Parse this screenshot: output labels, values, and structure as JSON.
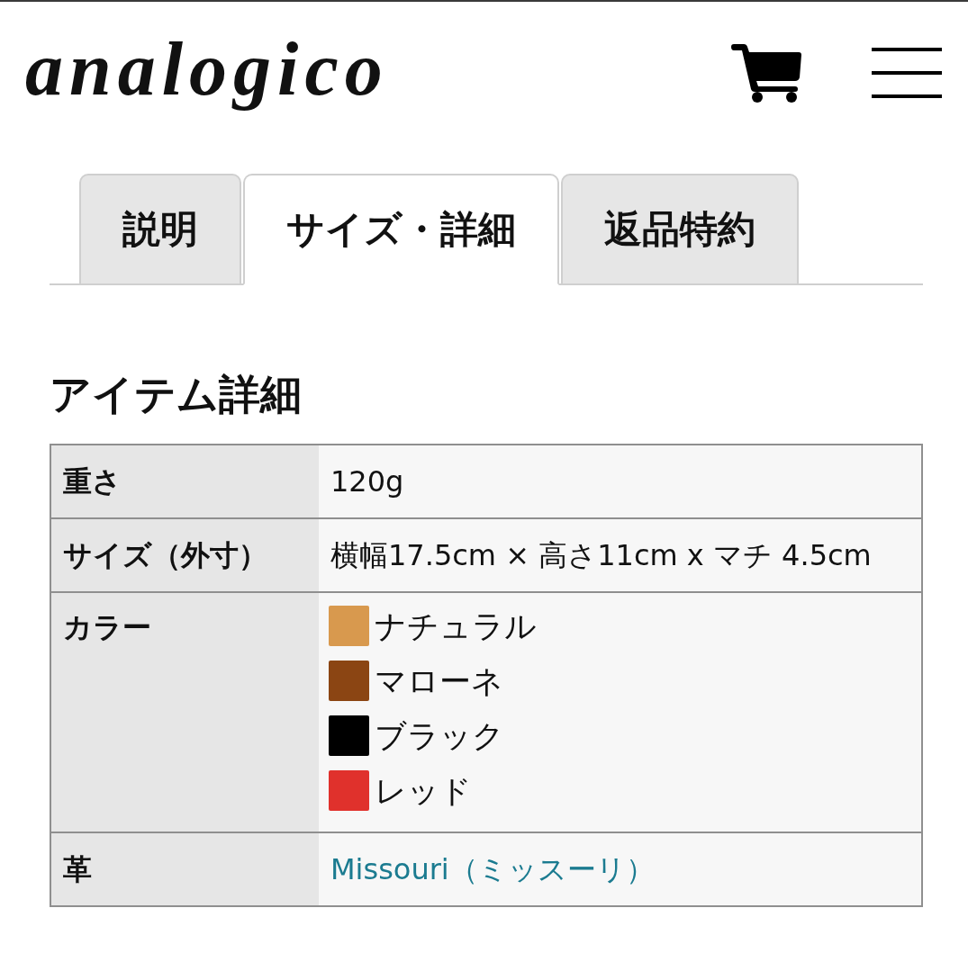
{
  "header": {
    "logo": "analogico"
  },
  "tabs": [
    {
      "label": "説明",
      "selected": false
    },
    {
      "label": "サイズ・詳細",
      "selected": true
    },
    {
      "label": "返品特約",
      "selected": false
    }
  ],
  "section": {
    "title": "アイテム詳細"
  },
  "table": {
    "rows": [
      {
        "kind": "text",
        "label": "重さ",
        "value": "120g"
      },
      {
        "kind": "text",
        "label": "サイズ（外寸）",
        "value": "横幅17.5cm × 高さ11cm x マチ 4.5cm"
      },
      {
        "kind": "colors",
        "label": "カラー",
        "colors": [
          {
            "name": "ナチュラル",
            "color": "#d8994e"
          },
          {
            "name": "マローネ",
            "color": "#8b4513"
          },
          {
            "name": "ブラック",
            "color": "#000000"
          },
          {
            "name": "レッド",
            "color": "#e0312c"
          }
        ]
      },
      {
        "kind": "link",
        "label": "革",
        "value": "Missouri（ミッスーリ）"
      }
    ]
  }
}
